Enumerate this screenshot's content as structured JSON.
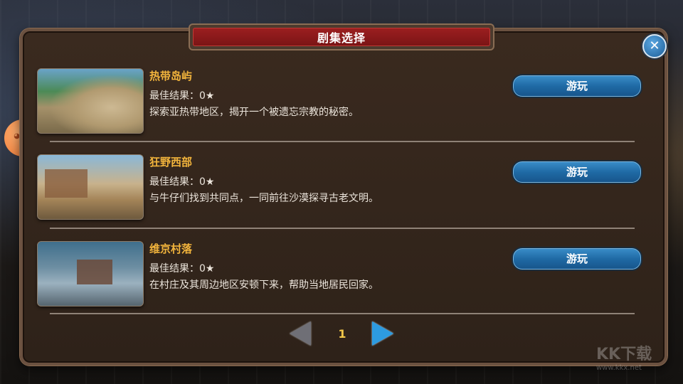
{
  "dialog": {
    "title": "剧集选择",
    "close_symbol": "✕"
  },
  "episodes": [
    {
      "title": "热带岛屿",
      "score": "最佳结果：0★",
      "description": "探索亚热带地区，揭开一个被遗忘宗教的秘密。",
      "play_label": "游玩"
    },
    {
      "title": "狂野西部",
      "score": "最佳结果：0★",
      "description": "与牛仔们找到共同点，一同前往沙漠探寻古老文明。",
      "play_label": "游玩"
    },
    {
      "title": "维京村落",
      "score": "最佳结果：0★",
      "description": "在村庄及其周边地区安顿下来，帮助当地居民回家。",
      "play_label": "游玩"
    }
  ],
  "pagination": {
    "current_page": "1"
  },
  "watermark": {
    "text": "KK下载",
    "url": "www.kkx.net"
  },
  "icons": {
    "close": "close-icon",
    "prev": "arrow-left-icon",
    "next": "arrow-right-icon",
    "mascot": "mascot-icon"
  }
}
